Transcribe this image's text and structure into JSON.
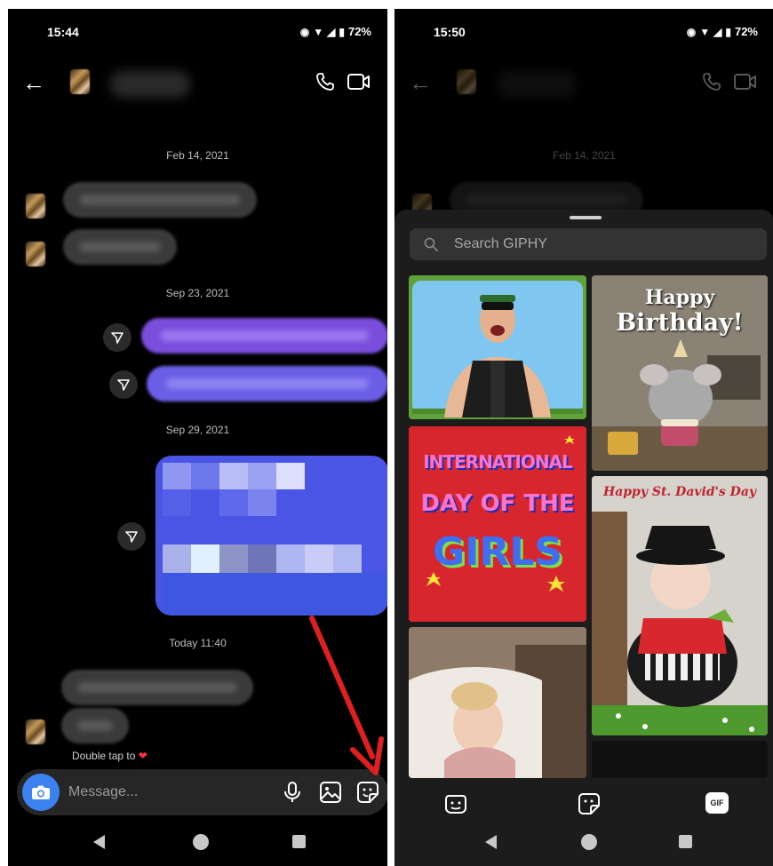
{
  "left_screen": {
    "status": {
      "time": "15:44",
      "battery": "72%"
    },
    "dates": [
      "Feb 14, 2021",
      "Sep 23, 2021",
      "Sep 29, 2021",
      "Today 11:40"
    ],
    "double_tap_hint": "Double tap to",
    "composer": {
      "placeholder": "Message..."
    }
  },
  "right_screen": {
    "status": {
      "time": "15:50",
      "battery": "72%"
    },
    "date": "Feb 14, 2021",
    "giphy": {
      "search_placeholder": "Search GIPHY",
      "tiles": [
        {
          "name": "gif-man-shouting"
        },
        {
          "name": "gif-happy-birthday",
          "line1": "Happy",
          "line2": "Birthday!"
        },
        {
          "name": "gif-international-day-of-the-girls",
          "line1": "INTERNATIONAL",
          "line2": "DAY OF THE",
          "line3": "GIRLS"
        },
        {
          "name": "gif-st-davids-day",
          "caption": "Happy St. David's Day"
        },
        {
          "name": "gif-baby"
        }
      ],
      "tabs": {
        "gif_label": "GIF"
      }
    }
  },
  "colors": {
    "background": "#000000",
    "sheet": "#1c1c1c",
    "accent_blue": "#3b82f0",
    "purple_bubble": "#7a4ddc",
    "annotation_red": "#e02020"
  }
}
